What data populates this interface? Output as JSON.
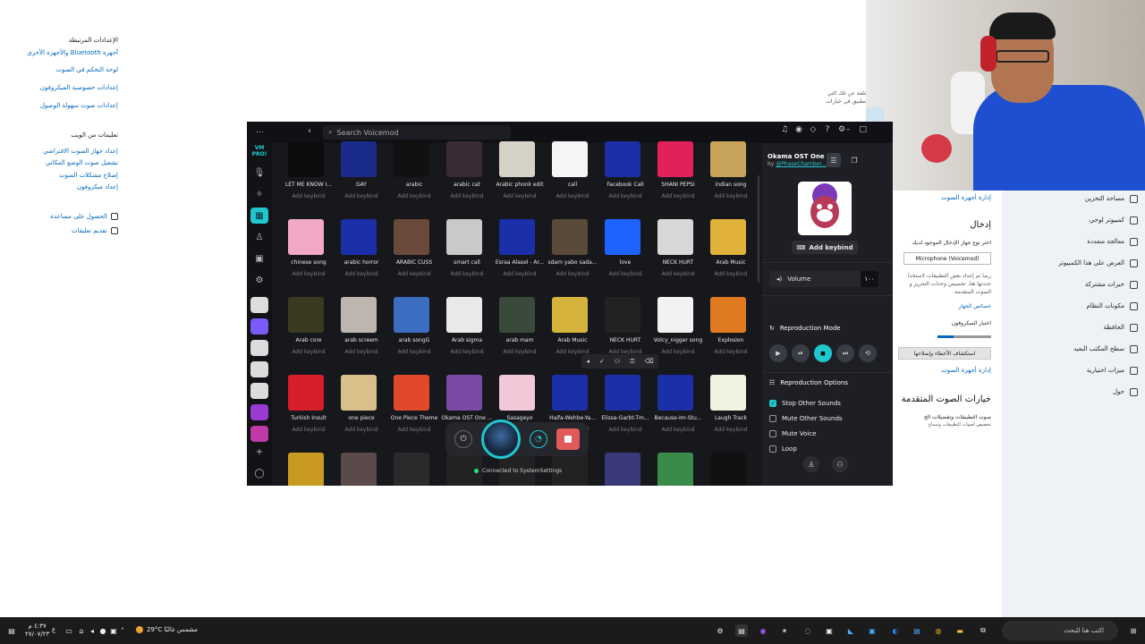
{
  "settings_left": {
    "related_title": "الإعدادات المرتبطة",
    "related_links": [
      "أجهزة Bluetooth والأجهزة الأخرى",
      "لوحة التحكم في الصوت",
      "إعدادات خصوصية الميكروفون",
      "إعدادات صوت سهولة الوصول"
    ],
    "web_help_title": "تعليمات من الويب",
    "web_help_links": [
      "إعداد جهاز الصوت الافتراضي",
      "تشغيل صوت الوضع المكاني",
      "إصلاح مشكلات الصوت",
      "إعداد ميكروفون"
    ],
    "get_help": "الحصول على مساعدة",
    "give_feedback": "تقديم تعليقات"
  },
  "settings_faint": [
    "ه مختلفة عن تلك التي",
    "به بالتطبيق في خيارات"
  ],
  "settings_mid": {
    "manage_devices_1": "إدارة أجهزة الصوت",
    "input_heading": "إدخال",
    "choose_input": "اختر نوع جهاز الإدخال الموجود لديك",
    "selected_device": "Microphone (Voicemod)",
    "note_1": "ربما تم إعداد بعض التطبيقات لاستخدا",
    "note_2": "حددتها هنا. تخصيص وحدات التحرير و",
    "note_3": "الصوت المتقدمة.",
    "device_props": "خصائص الجهاز",
    "test_mic": "اختبار الميكروفون",
    "troubleshoot": "استكشاف الأخطاء وإصلاحها",
    "manage_devices_2": "إدارة أجهزة الصوت",
    "advanced_heading": "خيارات الصوت المتقدمة",
    "app_volume": "صوت التطبيقات وتفضيلات الج",
    "app_volume_sub": "تخصيص أصوات التطبيقات وسماع"
  },
  "settings_nav": [
    "مساحة التخزين",
    "كمبيوتر لوحي",
    "معالجة متعددة",
    "العرض على هذا الكمبيوتر",
    "خبرات مشتركة",
    "مكونات النظام",
    "الحافظة",
    "سطح المكتب البعيد",
    "ميزات اختيارية",
    "حول"
  ],
  "voicemod": {
    "dots": "...",
    "search_placeholder": "Search Voicemod",
    "logo_text": "VM PRO!",
    "sounds": [
      {
        "name": "LET ME KNOW I...",
        "keybind": "Add keybind",
        "color": "#0c0c0c"
      },
      {
        "name": "GAY",
        "keybind": "Add keybind",
        "color": "#1b2b8a"
      },
      {
        "name": "arabic",
        "keybind": "Add keybind",
        "color": "#111111"
      },
      {
        "name": "arabic cat",
        "keybind": "Add keybind",
        "color": "#3a2a35"
      },
      {
        "name": "Arabic phonk edit",
        "keybind": "Add keybind",
        "color": "#d7d2c8"
      },
      {
        "name": "call",
        "keybind": "Add keybind",
        "color": "#f5f5f5"
      },
      {
        "name": "Facebook Call",
        "keybind": "Add keybind",
        "color": "#1a2fa8"
      },
      {
        "name": "SHANI PEPSI",
        "keybind": "Add keybind",
        "color": "#e0215a"
      },
      {
        "name": "indian song",
        "keybind": "Add keybind",
        "color": "#c8a45a"
      },
      {
        "name": "chinese song",
        "keybind": "Add keybind",
        "color": "#f2a9c8"
      },
      {
        "name": "arabic horror",
        "keybind": "Add keybind",
        "color": "#1a2fa8"
      },
      {
        "name": "ARABIC CUSS",
        "keybind": "Add keybind",
        "color": "#6a4a3a"
      },
      {
        "name": "smart call",
        "keybind": "Add keybind",
        "color": "#c9c9c9"
      },
      {
        "name": "Esraa Alasel - Ar...",
        "keybind": "Add keybind",
        "color": "#1a2fa8"
      },
      {
        "name": "sdam yabo sada...",
        "keybind": "Add keybind",
        "color": "#5a4a3a"
      },
      {
        "name": "love",
        "keybind": "Add keybind",
        "color": "#1e63ff"
      },
      {
        "name": "NECK HURT",
        "keybind": "Add keybind",
        "color": "#d8d8d8"
      },
      {
        "name": "Arab Music",
        "keybind": "Add keybind",
        "color": "#e0b23a"
      },
      {
        "name": "Arab core",
        "keybind": "Add keybind",
        "color": "#3a3a22"
      },
      {
        "name": "arab screem",
        "keybind": "Add keybind",
        "color": "#bcb6ae"
      },
      {
        "name": "arab songG",
        "keybind": "Add keybind",
        "color": "#3b6ec0"
      },
      {
        "name": "Arab sigma",
        "keybind": "Add keybind",
        "color": "#e9e9e9"
      },
      {
        "name": "arab mam",
        "keybind": "Add keybind",
        "color": "#3a4a3a"
      },
      {
        "name": "Arab Music",
        "keybind": "Add keybind",
        "color": "#d6b33a"
      },
      {
        "name": "NECK HURT",
        "keybind": "Add keybind",
        "color": "#222222"
      },
      {
        "name": "Volcy_nigger song",
        "keybind": "Add keybind",
        "color": "#f2f2f2"
      },
      {
        "name": "Explosion",
        "keybind": "Add keybind",
        "color": "#e07a20"
      },
      {
        "name": "Turkish Insult",
        "keybind": "Add keybind",
        "color": "#d81e2a"
      },
      {
        "name": "one piece",
        "keybind": "Add keybind",
        "color": "#d9c08a"
      },
      {
        "name": "One Piece Theme",
        "keybind": "Add keybind",
        "color": "#e04a2a"
      },
      {
        "name": "Okama OST One ...",
        "keybind": "Add keybind",
        "color": "#7a4aa8"
      },
      {
        "name": "Sasageyo",
        "keybind": "Add keybind",
        "color": "#f0c8d8"
      },
      {
        "name": "Haifa-Wehbe-Ya...",
        "keybind": "Add keybind",
        "color": "#1a2fa8"
      },
      {
        "name": "Elissa-Garbt-Tm...",
        "keybind": "Add keybind",
        "color": "#1a2fa8"
      },
      {
        "name": "Because-Im-Stu...",
        "keybind": "Add keybind",
        "color": "#1a2fa8"
      },
      {
        "name": "Laugh Track",
        "keybind": "Add keybind",
        "color": "#f2f2e0"
      },
      {
        "name": "",
        "keybind": "",
        "color": "#c89a20"
      },
      {
        "name": "",
        "keybind": "",
        "color": "#5a4a4a"
      },
      {
        "name": "",
        "keybind": "",
        "color": "#2a2a2a"
      },
      {
        "name": "",
        "keybind": "",
        "color": "#222222"
      },
      {
        "name": "",
        "keybind": "",
        "color": "#222222"
      },
      {
        "name": "",
        "keybind": "",
        "color": "#222222"
      },
      {
        "name": "",
        "keybind": "",
        "color": "#3a3a7a"
      },
      {
        "name": "",
        "keybind": "",
        "color": "#3a8a4a"
      },
      {
        "name": "",
        "keybind": "",
        "color": "#111111"
      }
    ],
    "player_status": "Connected to SystemSettings",
    "side": {
      "title": "Okama OST One ...",
      "by_prefix": "by ",
      "author": "@PhaseChamber...",
      "add_keybind": "Add keybind",
      "volume_label": "Volume",
      "volume_value": "١٠٠",
      "repro_mode": "Reproduction Mode",
      "repro_options": "Reproduction Options",
      "options": [
        {
          "label": "Stop Other Sounds",
          "checked": true
        },
        {
          "label": "Mute Other Sounds",
          "checked": false
        },
        {
          "label": "Mute Voice",
          "checked": false
        },
        {
          "label": "Loop",
          "checked": false
        }
      ]
    },
    "accent": "#1fc8cf"
  },
  "taskbar": {
    "clock_time": "٤:٣٧ م",
    "clock_date": "٢٧/٠٧/٢٣",
    "lang": "ع",
    "weather": "29°C  مشمس غالبًا",
    "search_placeholder": "اكتب هنا للبحث"
  }
}
